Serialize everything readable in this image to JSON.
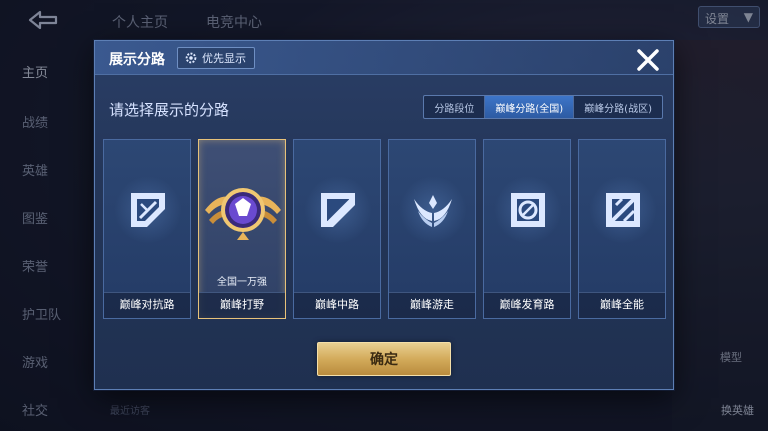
{
  "background": {
    "top_tabs": [
      "个人主页",
      "电竞中心"
    ],
    "settings_label": "设置",
    "sidebar_items": [
      "主页",
      "战绩",
      "英雄",
      "图鉴",
      "荣誉",
      "护卫队",
      "游戏",
      "社交"
    ],
    "recent_visitors_label": "最近访客",
    "model_label": "模型",
    "swap_hero_label": "换英雄"
  },
  "modal": {
    "title": "展示分路",
    "priority_label": "优先显示",
    "subtitle": "请选择展示的分路",
    "segments": [
      "分路段位",
      "巅峰分路(全国)",
      "巅峰分路(战区)"
    ],
    "selected_segment_index": 1,
    "cards": [
      {
        "label": "巅峰对抗路",
        "rank": "",
        "icon": "sword-shield-icon",
        "selected": false
      },
      {
        "label": "巅峰打野",
        "rank": "全国一万强",
        "icon": "jungle-emblem-icon",
        "selected": true
      },
      {
        "label": "巅峰中路",
        "rank": "",
        "icon": "slash-icon",
        "selected": false
      },
      {
        "label": "巅峰游走",
        "rank": "",
        "icon": "wings-icon",
        "selected": false
      },
      {
        "label": "巅峰发育路",
        "rank": "",
        "icon": "target-icon",
        "selected": false
      },
      {
        "label": "巅峰全能",
        "rank": "",
        "icon": "allround-icon",
        "selected": false
      }
    ],
    "confirm_label": "确定"
  },
  "colors": {
    "accent_gold": "#d3ab5b",
    "segment_selected": "#2d5ba3",
    "modal_bg": "#243659"
  }
}
